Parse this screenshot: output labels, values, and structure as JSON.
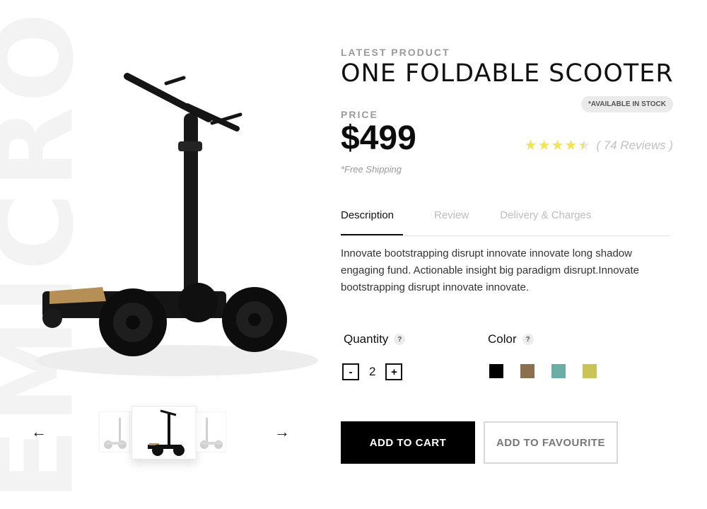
{
  "watermark": {
    "text": "EMICRO"
  },
  "product": {
    "overline": "LATEST PRODUCT",
    "title": "ONE FOLDABLE SCOOTER",
    "stock_badge": "*AVAILABLE IN STOCK",
    "price_label": "PRICE",
    "price": "$499",
    "shipping": "*Free Shipping",
    "rating": {
      "stars_out_of_5": 4.5,
      "reviews_text": "( 74 Reviews )"
    }
  },
  "tabs": [
    {
      "label": "Description",
      "active": true
    },
    {
      "label": "Review",
      "active": false
    },
    {
      "label": "Delivery & Charges",
      "active": false
    }
  ],
  "description": "Innovate bootstrapping disrupt innovate innovate long shadow engaging fund. Actionable insight big paradigm disrupt.Innovate bootstrapping disrupt innovate innovate.",
  "quantity": {
    "label": "Quantity",
    "help": "?",
    "minus": "-",
    "value": "2",
    "plus": "+"
  },
  "color": {
    "label": "Color",
    "help": "?",
    "swatches": [
      "#000000",
      "#8b6f4e",
      "#6aaea7",
      "#c8c458"
    ]
  },
  "gallery": {
    "prev_icon": "arrow-left-icon",
    "next_icon": "arrow-right-icon",
    "prev": "←",
    "next": "→"
  },
  "actions": {
    "add_to_cart": "ADD TO CART",
    "add_to_favourite": "ADD TO FAVOURITE"
  },
  "colors": {
    "star": "#f2e350",
    "button_primary": "#000000",
    "muted": "#9a9a9a"
  }
}
